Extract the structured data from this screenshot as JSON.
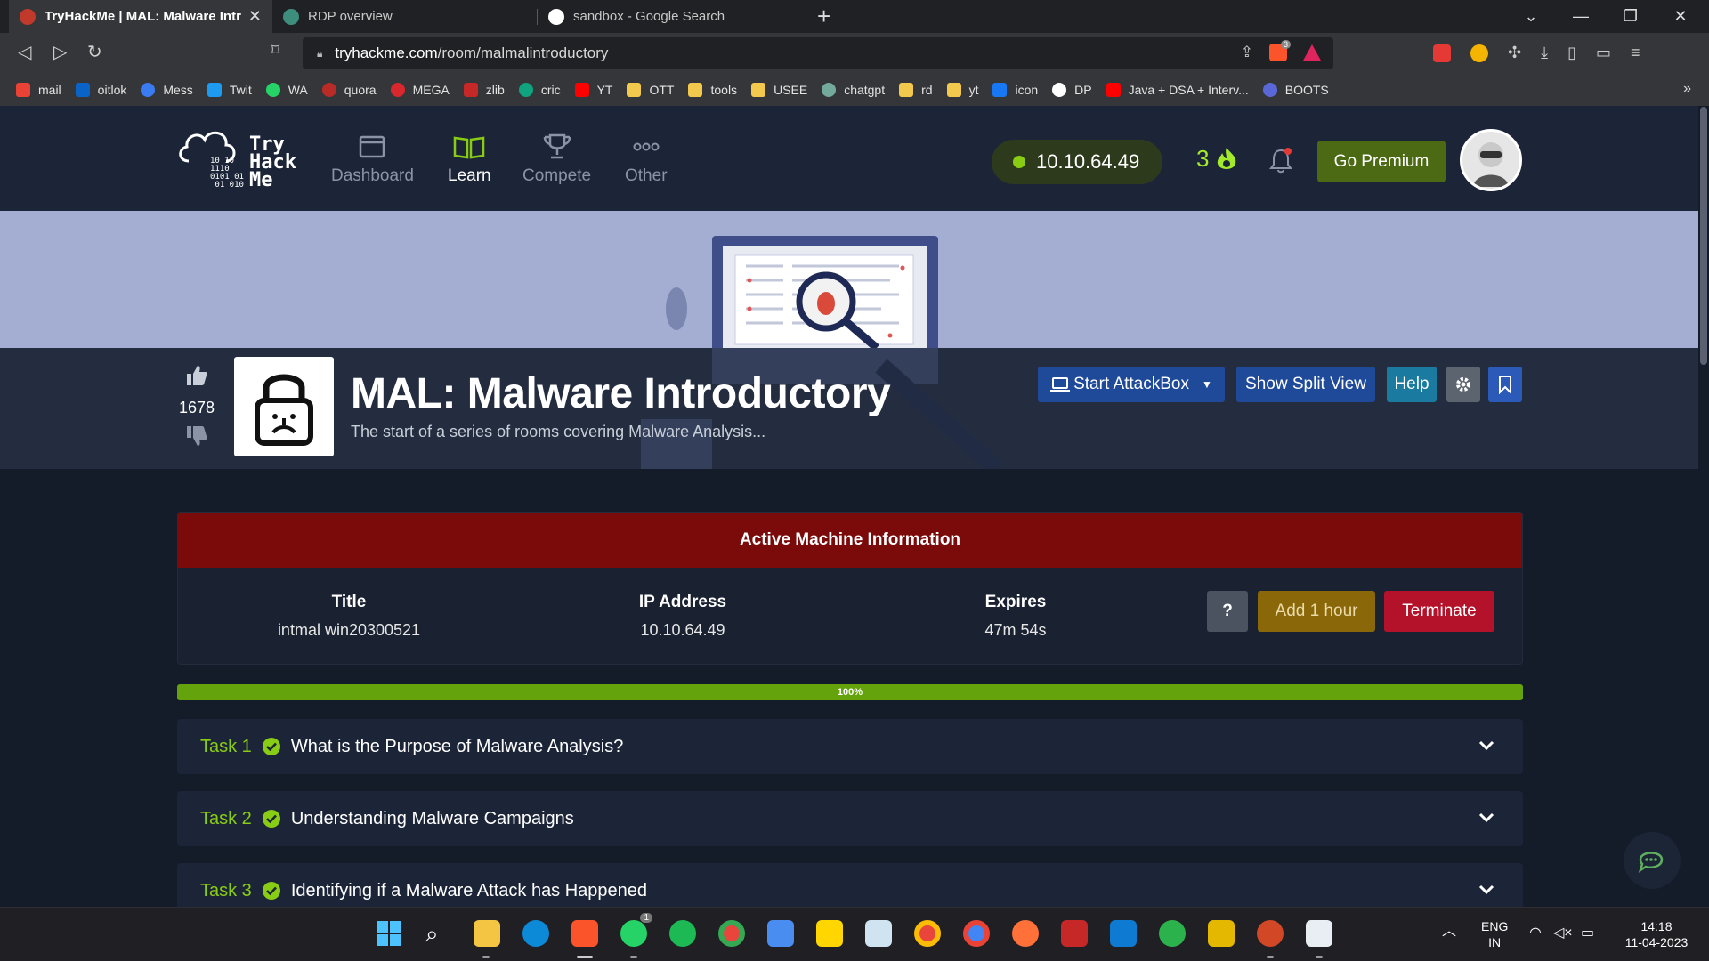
{
  "browser": {
    "tabs": [
      {
        "title": "TryHackMe | MAL: Malware Introd",
        "active": true
      },
      {
        "title": "RDP overview",
        "active": false
      },
      {
        "title": "sandbox - Google Search",
        "active": false
      }
    ],
    "url_domain": "tryhackme.com",
    "url_path": "/room/malmalintroductory",
    "bookmarks": [
      "mail",
      "oitlok",
      "Mess",
      "Twit",
      "WA",
      "quora",
      "MEGA",
      "zlib",
      "cric",
      "YT",
      "OTT",
      "tools",
      "USEE",
      "chatgpt",
      "rd",
      "yt",
      "icon",
      "DP",
      "Java + DSA + Interv...",
      "BOOTS"
    ],
    "bookmark_more": "»",
    "brave_badge": "3"
  },
  "header": {
    "logo_line1": "Try",
    "logo_line2": "Hack",
    "logo_line3": "Me",
    "nav": [
      {
        "label": "Dashboard",
        "icon": "dashboard-icon",
        "active": false
      },
      {
        "label": "Learn",
        "icon": "book-icon",
        "active": true
      },
      {
        "label": "Compete",
        "icon": "trophy-icon",
        "active": false
      },
      {
        "label": "Other",
        "icon": "more-icon",
        "active": false
      }
    ],
    "machine_ip": "10.10.64.49",
    "streak": "3",
    "premium_label": "Go Premium"
  },
  "room": {
    "upvotes": "1678",
    "title": "MAL: Malware Introductory",
    "subtitle": "The start of a series of rooms covering Malware Analysis...",
    "buttons": {
      "attackbox": "Start AttackBox",
      "split_view": "Show Split View",
      "help": "Help"
    }
  },
  "machine": {
    "heading": "Active Machine Information",
    "title_label": "Title",
    "title_value": "intmal win20300521",
    "ip_label": "IP Address",
    "ip_value": "10.10.64.49",
    "expires_label": "Expires",
    "expires_value": "47m 54s",
    "question_label": "?",
    "add_hour_label": "Add 1 hour",
    "terminate_label": "Terminate"
  },
  "progress": {
    "value": 100,
    "label": "100%"
  },
  "tasks": [
    {
      "number": "Task 1",
      "title": "What is the Purpose of Malware Analysis?",
      "completed": true
    },
    {
      "number": "Task 2",
      "title": "Understanding Malware Campaigns",
      "completed": true
    },
    {
      "number": "Task 3",
      "title": "Identifying if a Malware Attack has Happened",
      "completed": true
    }
  ],
  "taskbar": {
    "lang_line1": "ENG",
    "lang_line2": "IN",
    "time": "14:18",
    "date": "11-04-2023",
    "whatsapp_badge": "1"
  },
  "colors": {
    "thm_green": "#88cc14",
    "machine_red": "#7b0a0a",
    "terminate_red": "#b4122a",
    "add_hour_gold": "#8a6708",
    "attackbox_blue": "#1e4a99"
  }
}
